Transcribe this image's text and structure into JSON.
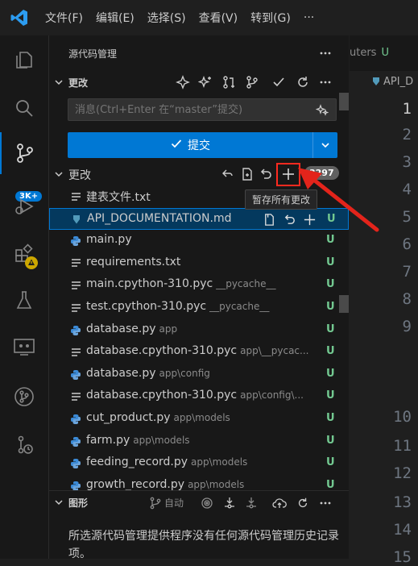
{
  "menu": [
    "文件(F)",
    "编辑(E)",
    "选择(S)",
    "查看(V)",
    "转到(G)",
    "···"
  ],
  "activity_badge": "3K+",
  "sidebar": {
    "title": "源代码管理",
    "changes_header": "更改",
    "message_placeholder": "消息(Ctrl+Enter 在“master”提交)",
    "commit_label": "提交",
    "changes_group": "更改",
    "change_count": "3297",
    "tooltip": "暂存所有更改",
    "files": [
      {
        "name": "建表文件.txt",
        "path": "",
        "icon": "text",
        "status": ""
      },
      {
        "name": "API_DOCUMENTATION.md",
        "path": "",
        "icon": "markdown",
        "status": "U"
      },
      {
        "name": "main.py",
        "path": "",
        "icon": "python",
        "status": "U"
      },
      {
        "name": "requirements.txt",
        "path": "",
        "icon": "text",
        "status": "U"
      },
      {
        "name": "main.cpython-310.pyc",
        "path": "__pycache__",
        "icon": "text",
        "status": "U"
      },
      {
        "name": "test.cpython-310.pyc",
        "path": "__pycache__",
        "icon": "text",
        "status": "U"
      },
      {
        "name": "database.py",
        "path": "app",
        "icon": "python",
        "status": "U"
      },
      {
        "name": "database.cpython-310.pyc",
        "path": "app\\__pycac...",
        "icon": "text",
        "status": "U"
      },
      {
        "name": "database.py",
        "path": "app\\config",
        "icon": "python",
        "status": "U"
      },
      {
        "name": "database.cpython-310.pyc",
        "path": "app\\config\\...",
        "icon": "text",
        "status": "U"
      },
      {
        "name": "cut_product.py",
        "path": "app\\models",
        "icon": "python",
        "status": "U"
      },
      {
        "name": "farm.py",
        "path": "app\\models",
        "icon": "python",
        "status": "U"
      },
      {
        "name": "feeding_record.py",
        "path": "app\\models",
        "icon": "python",
        "status": "U"
      },
      {
        "name": "growth_record.py",
        "path": "app\\models",
        "icon": "python",
        "status": "U"
      }
    ],
    "graph_header": "图形",
    "graph_auto": "自动",
    "graph_message": "所选源代码管理提供程序没有任何源代码管理历史记录项。"
  },
  "editor": {
    "tab_label": "uters",
    "tab_status": "U",
    "breadcrumb": "API_D",
    "line_numbers": [
      "1",
      "2",
      "3",
      "4",
      "5",
      "6",
      "7",
      "8",
      "9",
      "10",
      "11",
      "12",
      "13",
      "14",
      "15"
    ]
  },
  "colors": {
    "accent": "#0078d4",
    "untracked": "#73c991",
    "annotation": "#ff2a1f"
  }
}
